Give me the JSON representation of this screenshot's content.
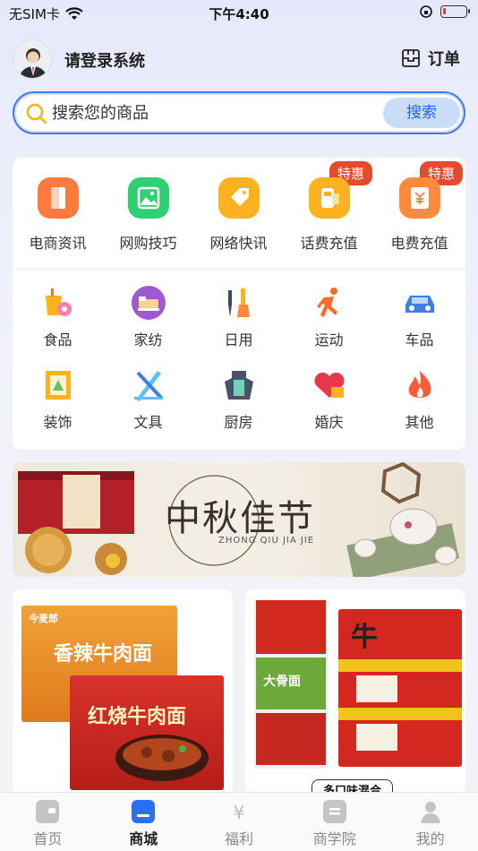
{
  "status_bar": {
    "carrier": "无SIM卡",
    "time": "下午4:40",
    "battery_level": 0.12
  },
  "header": {
    "login_text": "请登录系统",
    "orders_label": "订单"
  },
  "search": {
    "placeholder": "搜索您的商品",
    "button_label": "搜索"
  },
  "top_categories": [
    {
      "label": "电商资讯",
      "icon": "news-door-icon",
      "color": "#ff7a3c",
      "badge": ""
    },
    {
      "label": "网购技巧",
      "icon": "picture-icon",
      "color": "#2fcf73",
      "badge": ""
    },
    {
      "label": "网络快讯",
      "icon": "tag-icon",
      "color": "#ffb21f",
      "badge": ""
    },
    {
      "label": "话费充值",
      "icon": "phone-charge-icon",
      "color": "#ffb21f",
      "badge": "特惠"
    },
    {
      "label": "电费充值",
      "icon": "electricity-bill-icon",
      "color": "#ff8a3c",
      "badge": "特惠"
    }
  ],
  "categories": [
    {
      "label": "食品",
      "icon": "food-icon"
    },
    {
      "label": "家纺",
      "icon": "bedding-icon"
    },
    {
      "label": "日用",
      "icon": "daily-use-icon"
    },
    {
      "label": "运动",
      "icon": "running-icon"
    },
    {
      "label": "车品",
      "icon": "car-icon"
    },
    {
      "label": "装饰",
      "icon": "frame-icon"
    },
    {
      "label": "文具",
      "icon": "stationery-icon"
    },
    {
      "label": "厨房",
      "icon": "apron-icon"
    },
    {
      "label": "婚庆",
      "icon": "heart-icon"
    },
    {
      "label": "其他",
      "icon": "flame-icon"
    }
  ],
  "banner": {
    "title": "中秋佳节",
    "subtitle": "ZHONG QIU JIA JIE"
  },
  "products": {
    "left": {
      "pack1": "香辣牛肉面",
      "pack2": "红烧牛肉面",
      "brand": "今麦郎"
    },
    "right": {
      "pack1": "大骨面",
      "pack2": "牛",
      "caption": "多口味混合"
    }
  },
  "tabs": [
    {
      "label": "首页",
      "icon": "home-icon",
      "active": false
    },
    {
      "label": "商城",
      "icon": "mall-icon",
      "active": true
    },
    {
      "label": "福利",
      "icon": "welfare-icon",
      "active": false
    },
    {
      "label": "商学院",
      "icon": "academy-icon",
      "active": false
    },
    {
      "label": "我的",
      "icon": "profile-icon",
      "active": false
    }
  ]
}
